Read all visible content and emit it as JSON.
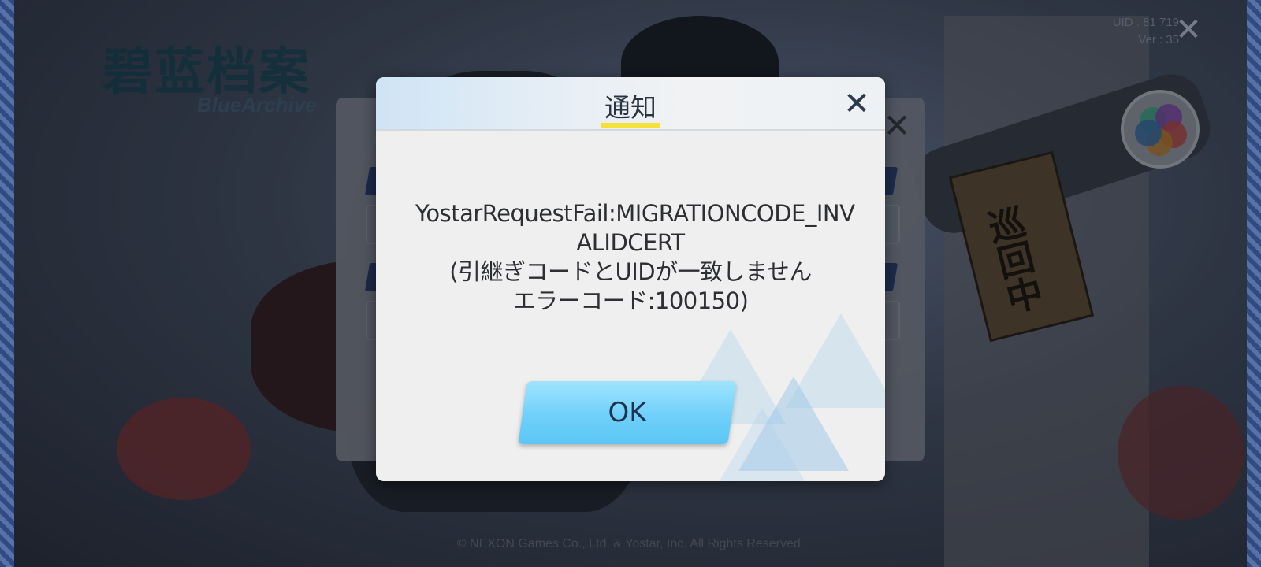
{
  "game": {
    "logo_text": "碧蓝档案",
    "logo_subtitle": "BlueArchive",
    "uid_label": "UID : 81 719",
    "version_label": "Ver : 35",
    "copyright": "© NEXON Games Co., Ltd. & Yostar, Inc. All Rights Reserved.",
    "sign_text": "巡回中"
  },
  "icons": {
    "top_close": "close-icon",
    "menu": "menu-flower-icon",
    "dialog_close": "close-icon",
    "back_close": "close-icon"
  },
  "dialog": {
    "title": "通知",
    "close_glyph": "✕",
    "message_lines": [
      "YostarRequestFail:MIGRATIONCODE_INV",
      "ALIDCERT",
      "(引継ぎコードとUIDが一致しません",
      "エラーコード:100150)"
    ],
    "ok_label": "OK"
  },
  "glyphs": {
    "close": "✕"
  },
  "colors": {
    "ok_button": "#6fd0fa",
    "title_underline": "#f4e23a",
    "dialog_bg": "#efefef"
  }
}
